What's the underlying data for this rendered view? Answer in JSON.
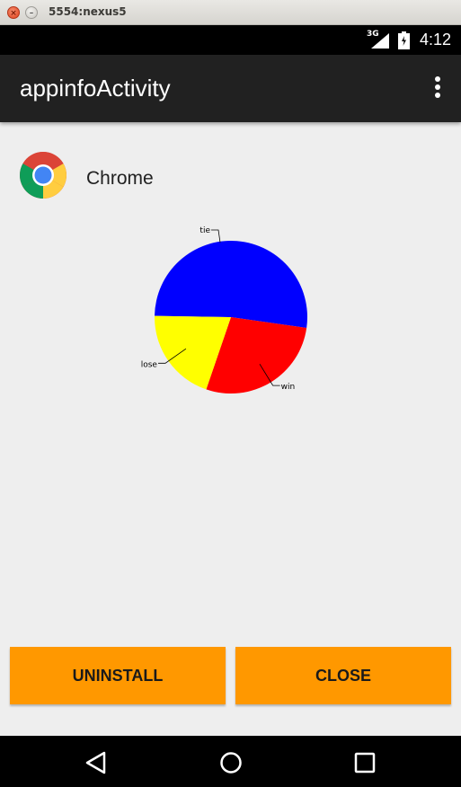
{
  "window": {
    "title": "5554:nexus5"
  },
  "status_bar": {
    "network": "3G",
    "time": "4:12"
  },
  "app_bar": {
    "title": "appinfoActivity"
  },
  "app": {
    "name": "Chrome"
  },
  "chart_data": {
    "type": "pie",
    "slices": [
      {
        "label": "tie",
        "value": 52,
        "color": "#0000ff"
      },
      {
        "label": "win",
        "value": 28,
        "color": "#ff0000"
      },
      {
        "label": "lose",
        "value": 20,
        "color": "#ffff00"
      }
    ]
  },
  "buttons": {
    "uninstall": "UNINSTALL",
    "close": "CLOSE"
  }
}
